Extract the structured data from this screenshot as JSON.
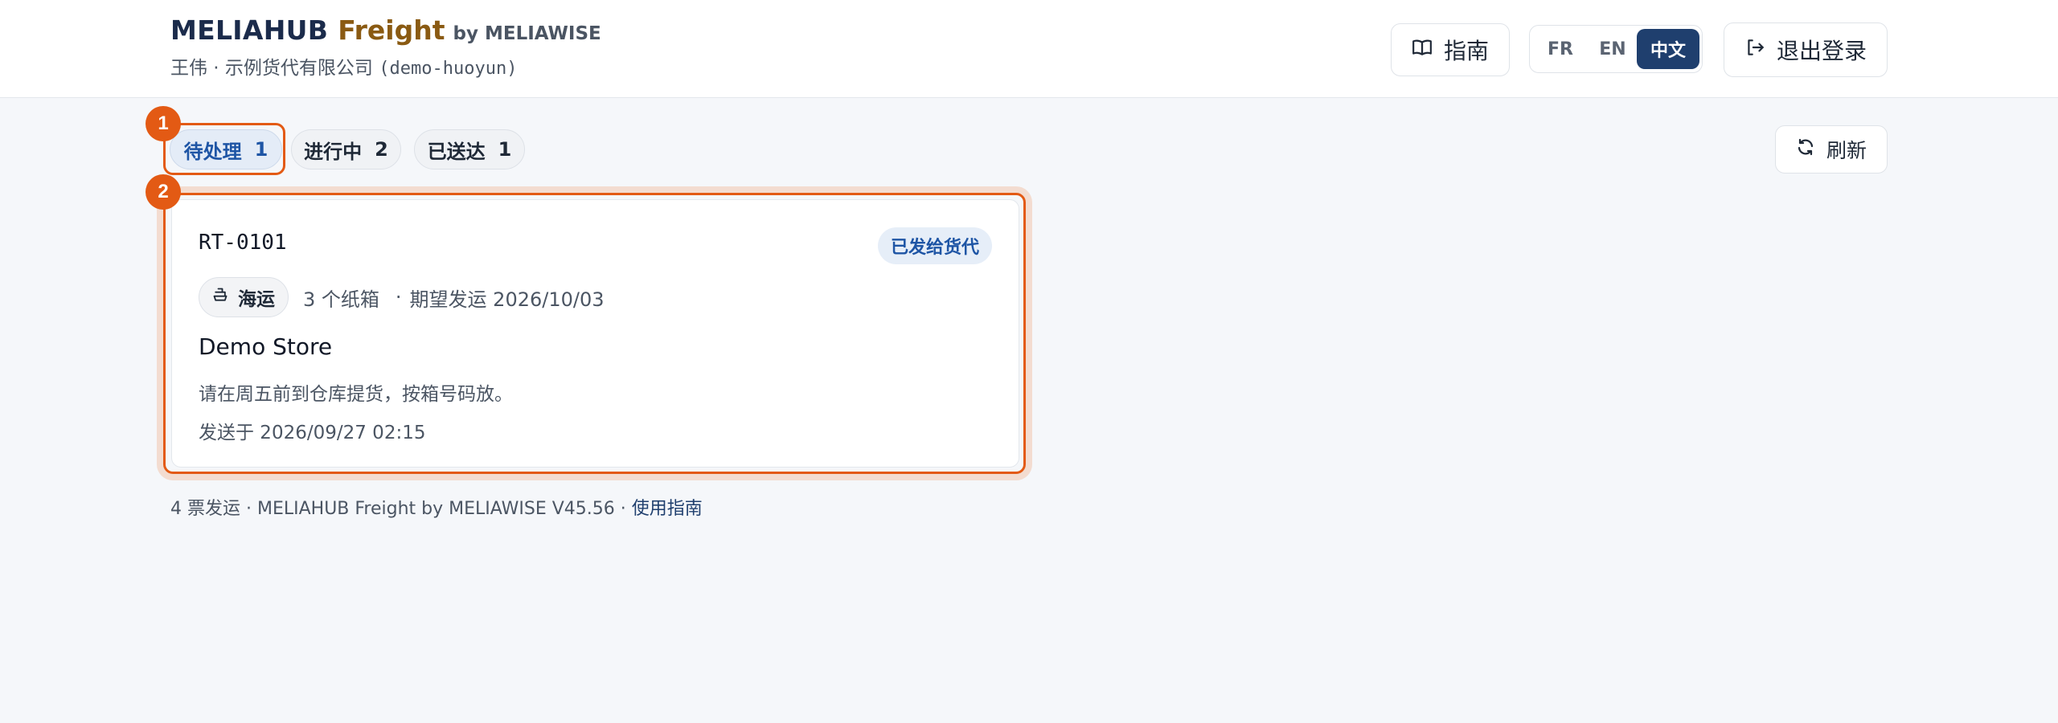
{
  "header": {
    "brand_main": "MELIAHUB",
    "brand_freight": "Freight",
    "brand_by": "by MELIAWISE",
    "user_line": "王伟 · 示例货代有限公司",
    "tenant_code": "(demo-huoyun)",
    "guide_label": "指南",
    "logout_label": "退出登录",
    "languages": [
      {
        "code": "FR",
        "active": false
      },
      {
        "code": "EN",
        "active": false
      },
      {
        "code": "中文",
        "active": true
      }
    ],
    "active_language_color": "#1f3f6e"
  },
  "tabs": [
    {
      "label": "待处理",
      "count": "1",
      "active": true
    },
    {
      "label": "进行中",
      "count": "2",
      "active": false
    },
    {
      "label": "已送达",
      "count": "1",
      "active": false
    }
  ],
  "refresh_label": "刷新",
  "annotations": [
    "1",
    "2"
  ],
  "shipments": [
    {
      "ref": "RT-0101",
      "status": "已发给货代",
      "mode_icon": "ship-icon",
      "mode": "海运",
      "cartons": "3 个纸箱",
      "expected": "期望发运 2026/10/03",
      "store": "Demo Store",
      "note": "请在周五前到仓库提货，按箱号码放。",
      "sent_at": "发送于 2026/09/27 02:15"
    }
  ],
  "footer": {
    "text": "4 票发运 · MELIAHUB Freight by MELIAWISE V45.56 · ",
    "link": "使用指南"
  },
  "colors": {
    "accent": "#e35a14",
    "brand_navy": "#1b2b4b",
    "brand_gold": "#8a5a12",
    "status_blue": "#1e55a5"
  }
}
